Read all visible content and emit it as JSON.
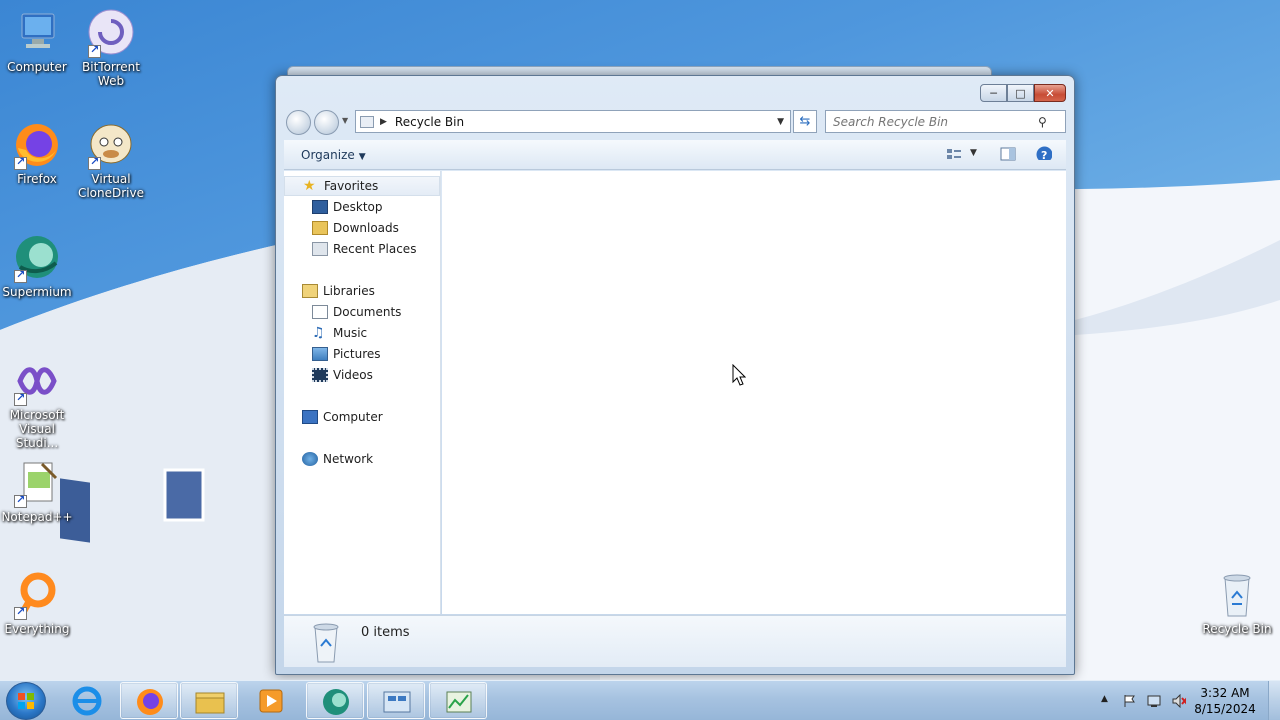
{
  "desktop": {
    "icons": [
      {
        "label": "Computer",
        "icon": "computer-icon"
      },
      {
        "label": "BitTorrent Web",
        "icon": "bittorrent-icon"
      },
      {
        "label": "Firefox",
        "icon": "firefox-icon"
      },
      {
        "label": "Virtual CloneDrive",
        "icon": "clonedrive-icon"
      },
      {
        "label": "Supermium",
        "icon": "supermium-icon"
      },
      {
        "label": "Microsoft Visual Studi...",
        "icon": "visual-studio-icon"
      },
      {
        "label": "Notepad++",
        "icon": "notepadpp-icon"
      },
      {
        "label": "Everything",
        "icon": "everything-icon"
      },
      {
        "label": "Recycle Bin",
        "icon": "recycle-bin-icon"
      }
    ]
  },
  "explorer": {
    "address": {
      "location": "Recycle Bin"
    },
    "search": {
      "placeholder": "Search Recycle Bin"
    },
    "toolbar": {
      "organize_label": "Organize"
    },
    "nav": {
      "favorites": {
        "label": "Favorites",
        "items": [
          "Desktop",
          "Downloads",
          "Recent Places"
        ]
      },
      "libraries": {
        "label": "Libraries",
        "items": [
          "Documents",
          "Music",
          "Pictures",
          "Videos"
        ]
      },
      "computer": "Computer",
      "network": "Network"
    },
    "details": {
      "count": "0 items"
    }
  },
  "taskbar": {
    "apps": [
      "internet-explorer-icon",
      "firefox-icon",
      "windows-explorer-icon",
      "media-player-icon",
      "supermium-icon",
      "control-panel-icon",
      "task-manager-icon"
    ],
    "clock": {
      "time": "3:32 AM",
      "date": "8/15/2024"
    }
  },
  "colors": {
    "accent": "#3b86d3",
    "close": "#c74c35",
    "taskbar": "#a6c2e0"
  }
}
